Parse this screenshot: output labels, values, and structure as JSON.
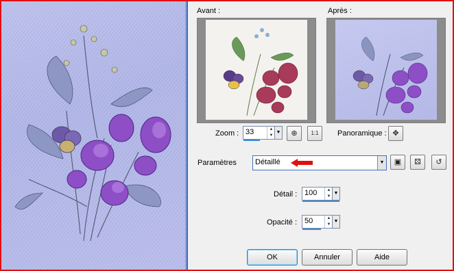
{
  "left_preview": {
    "watermark": ""
  },
  "panel": {
    "before_label": "Avant :",
    "after_label": "Après :",
    "zoom": {
      "label": "Zoom :",
      "value": "33"
    },
    "pan_label": "Panoramique :",
    "params": {
      "label": "Paramètres",
      "selected": "Détaillé"
    },
    "detail": {
      "label": "Détail :",
      "value": "100"
    },
    "opacity": {
      "label": "Opacité :",
      "value": "50"
    },
    "buttons": {
      "ok": "OK",
      "cancel": "Annuler",
      "help": "Aide"
    },
    "fit_icon_text": "1:1"
  },
  "colors": {
    "accent": "#3c8ad8",
    "frame": "#e01010",
    "pointer_arrow": "#e01010"
  }
}
